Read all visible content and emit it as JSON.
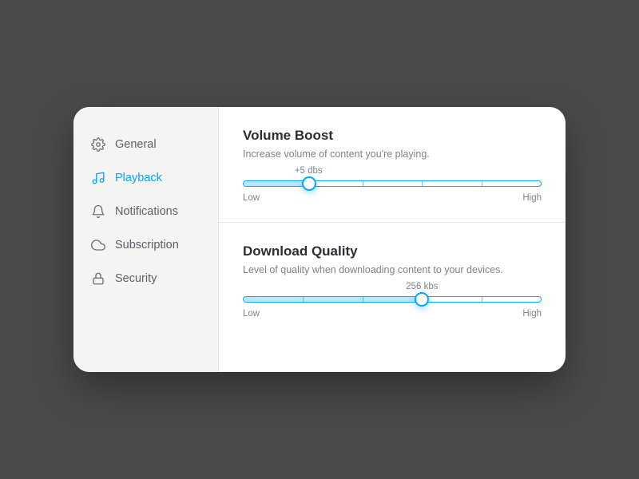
{
  "sidebar": {
    "items": [
      {
        "label": "General",
        "icon": "gear-icon"
      },
      {
        "label": "Playback",
        "icon": "music-note-icon"
      },
      {
        "label": "Notifications",
        "icon": "bell-icon"
      },
      {
        "label": "Subscription",
        "icon": "cloud-icon"
      },
      {
        "label": "Security",
        "icon": "lock-icon"
      }
    ],
    "active_index": 1
  },
  "sections": {
    "volume_boost": {
      "title": "Volume Boost",
      "description": "Increase volume of content you're playing.",
      "value_label": "+5 dbs",
      "min_label": "Low",
      "max_label": "High",
      "fill_percent": 22,
      "ticks_percent": [
        20,
        40,
        60,
        80
      ]
    },
    "download_quality": {
      "title": "Download Quality",
      "description": "Level of quality when downloading content to your devices.",
      "value_label": "256 kbs",
      "min_label": "Low",
      "max_label": "High",
      "fill_percent": 60,
      "ticks_percent": [
        20,
        40,
        60,
        80
      ]
    }
  },
  "colors": {
    "accent": "#00a8ff"
  }
}
